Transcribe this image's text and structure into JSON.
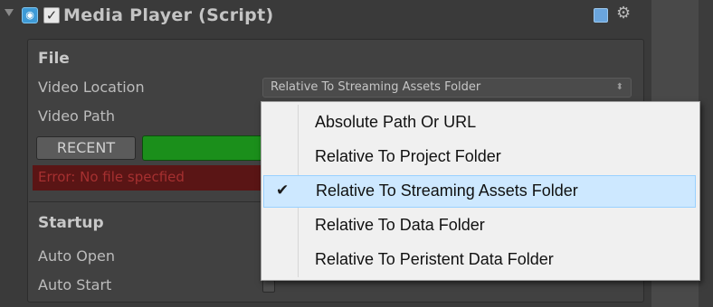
{
  "header": {
    "title": "Media Player (Script)",
    "enabled": true,
    "icons": {
      "foldout": "foldout-arrow-icon",
      "script": "script-icon",
      "help": "help-icon",
      "settings": "gear-icon"
    }
  },
  "file_section": {
    "heading": "File",
    "video_location_label": "Video Location",
    "video_location_value": "Relative To Streaming Assets Folder",
    "video_path_label": "Video Path",
    "recent_button": "RECENT",
    "error_text": "Error: No file specfied"
  },
  "startup_section": {
    "heading": "Startup",
    "auto_open_label": "Auto Open",
    "auto_start_label": "Auto Start"
  },
  "location_menu": {
    "items": [
      {
        "label": "Absolute Path Or URL",
        "checked": false
      },
      {
        "label": "Relative To Project Folder",
        "checked": false
      },
      {
        "label": "Relative To Streaming Assets Folder",
        "checked": true
      },
      {
        "label": "Relative To Data Folder",
        "checked": false
      },
      {
        "label": "Relative To Peristent Data Folder",
        "checked": false
      }
    ],
    "check_glyph": "✔"
  },
  "colors": {
    "background": "#3a3a3a",
    "browse_button": "#1b8f1b",
    "error_background": "#5a1515",
    "error_text": "#a63030",
    "menu_background": "#f0f0f0",
    "menu_selected": "#cde8ff"
  }
}
